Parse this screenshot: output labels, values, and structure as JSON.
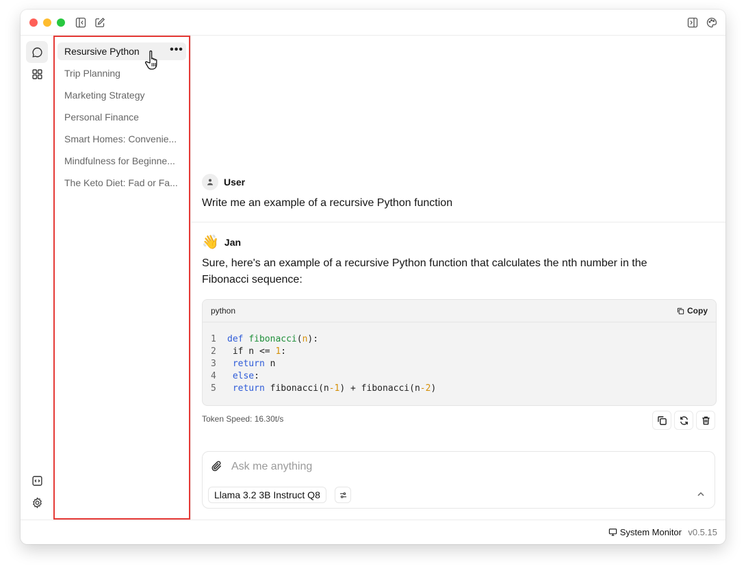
{
  "titlebar": {
    "icons": [
      "sidebar-collapse-icon",
      "new-chat-edit-icon",
      "right-panel-toggle-icon",
      "palette-icon"
    ]
  },
  "rail": {
    "top": [
      {
        "icon": "chat-bubble-icon",
        "active": true
      },
      {
        "icon": "grid-apps-icon",
        "active": false
      }
    ],
    "bottom": [
      {
        "icon": "code-brackets-icon"
      },
      {
        "icon": "settings-gear-icon"
      }
    ]
  },
  "sidebar": {
    "threads": [
      {
        "label": "Resursive Python",
        "active": true
      },
      {
        "label": "Trip Planning"
      },
      {
        "label": "Marketing Strategy"
      },
      {
        "label": "Personal Finance"
      },
      {
        "label": "Smart Homes: Convenie..."
      },
      {
        "label": "Mindfulness for Beginne..."
      },
      {
        "label": "The Keto Diet: Fad or Fa..."
      }
    ],
    "more_label": "•••"
  },
  "chat": {
    "user": {
      "name": "User",
      "text": "Write me an example of a recursive Python function"
    },
    "assistant": {
      "emoji": "👋",
      "name": "Jan",
      "text_line1": "Sure, here's an example of a recursive Python function that calculates the nth number in the",
      "text_line2": "Fibonacci sequence:",
      "code": {
        "language": "python",
        "copy_label": "Copy",
        "line_numbers": [
          "1",
          "2",
          "3",
          "4",
          "5"
        ]
      },
      "token_speed": "Token Speed: 16.30t/s"
    }
  },
  "composer": {
    "placeholder": "Ask me anything",
    "value": "",
    "model": "Llama 3.2 3B Instruct Q8"
  },
  "footer": {
    "system_monitor": "System Monitor",
    "version": "v0.5.15"
  },
  "colors": {
    "highlight_border": "#e53935",
    "keyword": "#2e5bd8",
    "function": "#1f8f3a",
    "number": "#d4900a"
  }
}
